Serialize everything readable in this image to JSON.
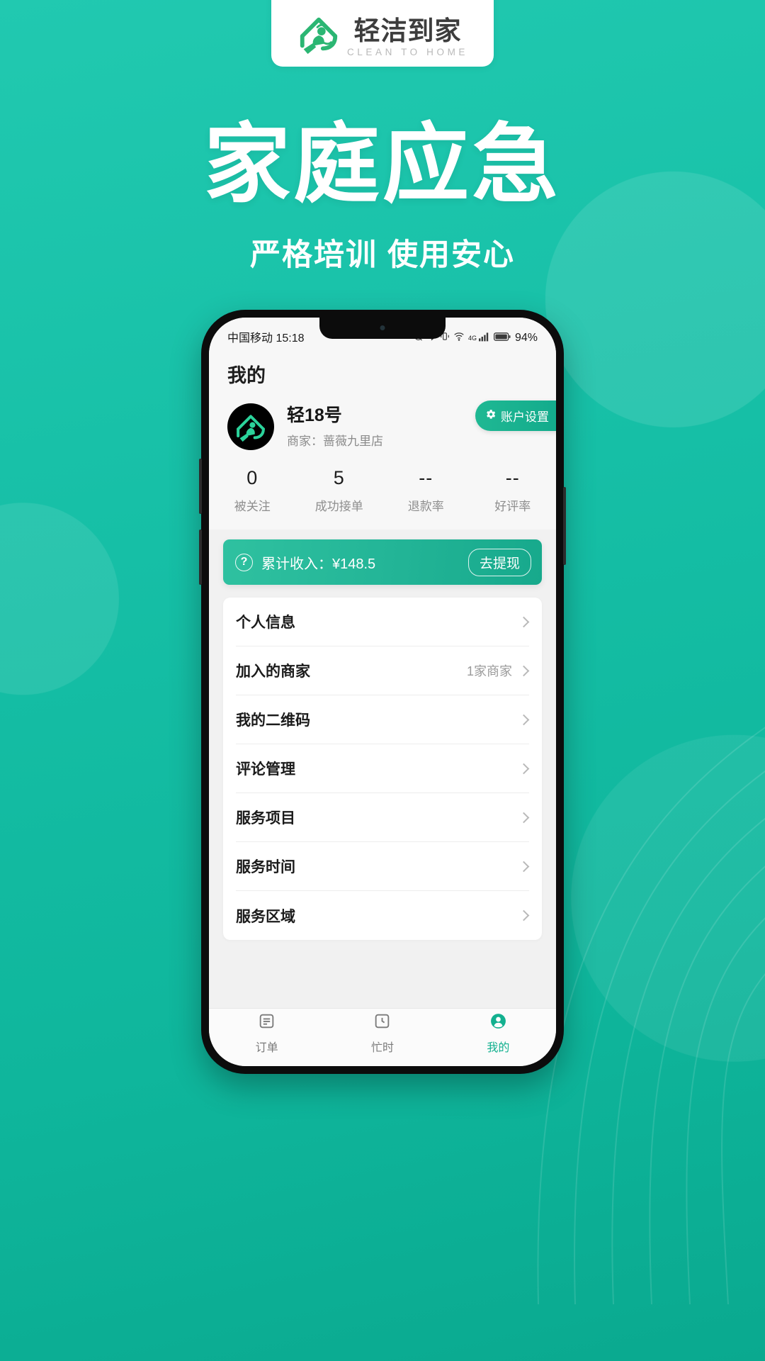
{
  "promo": {
    "logo": {
      "cn": "轻洁到家",
      "en": "CLEAN TO HOME",
      "icon": "house-cleaner-logo-icon"
    },
    "headline": "家庭应急",
    "subheadline": "严格培训 使用安心",
    "brand_color": "#16bfa6"
  },
  "phone": {
    "statusbar": {
      "carrier_time": "中国移动 15:18",
      "network": "4G",
      "battery_pct": "94%",
      "icons": [
        "alarm-muted-icon",
        "bluetooth-icon",
        "vibrate-icon",
        "wifi-icon",
        "signal-bars-icon",
        "battery-icon"
      ]
    },
    "page_title": "我的",
    "profile": {
      "avatar_icon": "brand-avatar-icon",
      "name": "轻18号",
      "shop": "商家：蔷薇九里店",
      "settings_label": "账户设置",
      "settings_icon": "gear-icon"
    },
    "stats": [
      {
        "value": "0",
        "label": "被关注"
      },
      {
        "value": "5",
        "label": "成功接单"
      },
      {
        "value": "--",
        "label": "退款率"
      },
      {
        "value": "--",
        "label": "好评率"
      }
    ],
    "income": {
      "help_icon": "question-mark-icon",
      "text": "累计收入：¥148.5",
      "withdraw_label": "去提现",
      "accent": "#23b597"
    },
    "menu": [
      {
        "label": "个人信息",
        "value": ""
      },
      {
        "label": "加入的商家",
        "value": "1家商家"
      },
      {
        "label": "我的二维码",
        "value": ""
      },
      {
        "label": "评论管理",
        "value": ""
      },
      {
        "label": "服务项目",
        "value": ""
      },
      {
        "label": "服务时间",
        "value": ""
      },
      {
        "label": "服务区域",
        "value": ""
      }
    ],
    "tabs": [
      {
        "label": "订单",
        "icon": "order-list-icon",
        "active": false
      },
      {
        "label": "忙时",
        "icon": "clock-icon",
        "active": false
      },
      {
        "label": "我的",
        "icon": "person-icon",
        "active": true
      }
    ],
    "active_tab_color": "#12b08f"
  }
}
